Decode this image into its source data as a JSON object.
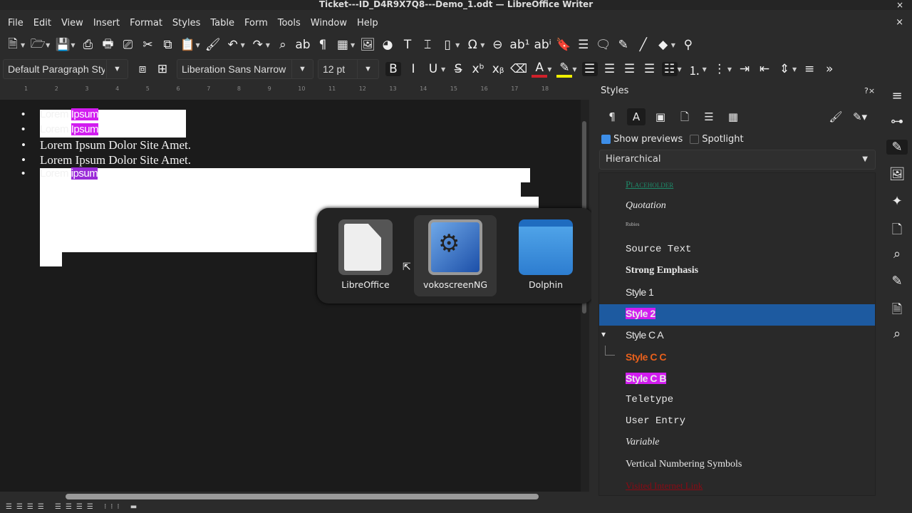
{
  "window": {
    "title": "Ticket---ID_D4R9X7Q8---Demo_1.odt — LibreOffice Writer",
    "close": "×"
  },
  "menu": [
    "File",
    "Edit",
    "View",
    "Insert",
    "Format",
    "Styles",
    "Table",
    "Form",
    "Tools",
    "Window",
    "Help"
  ],
  "doc_close": "×",
  "toolbar1": [
    {
      "n": "new-document-icon",
      "g": "🗎",
      "dd": true
    },
    {
      "n": "open-icon",
      "g": "🗁",
      "dd": true
    },
    {
      "n": "save-icon",
      "g": "💾",
      "dd": true
    },
    {
      "n": "export-pdf-icon",
      "g": "⎙"
    },
    {
      "n": "print-icon",
      "g": "🖶"
    },
    {
      "n": "print-preview-icon",
      "g": "⎚"
    },
    {
      "n": "cut-icon",
      "g": "✂"
    },
    {
      "n": "copy-icon",
      "g": "⧉"
    },
    {
      "n": "paste-icon",
      "g": "📋",
      "dd": true
    },
    {
      "n": "clone-formatting-icon",
      "g": "🖌"
    },
    {
      "n": "undo-icon",
      "g": "↶",
      "dd": true
    },
    {
      "n": "redo-icon",
      "g": "↷",
      "dd": true
    },
    {
      "n": "find-replace-icon",
      "g": "⌕"
    },
    {
      "n": "spelling-icon",
      "g": "ab"
    },
    {
      "n": "formatting-marks-icon",
      "g": "¶"
    },
    {
      "n": "insert-table-icon",
      "g": "▦",
      "dd": true
    },
    {
      "n": "insert-image-icon",
      "g": "🖼"
    },
    {
      "n": "insert-chart-icon",
      "g": "◕"
    },
    {
      "n": "insert-textbox-icon",
      "g": "T"
    },
    {
      "n": "page-break-icon",
      "g": "⌶"
    },
    {
      "n": "insert-field-icon",
      "g": "▯",
      "dd": true
    },
    {
      "n": "special-character-icon",
      "g": "Ω",
      "dd": true
    },
    {
      "n": "hyperlink-icon",
      "g": "⊖"
    },
    {
      "n": "footnote-icon",
      "g": "ab¹"
    },
    {
      "n": "endnote-icon",
      "g": "abⁱ"
    },
    {
      "n": "bookmark-icon",
      "g": "🔖"
    },
    {
      "n": "cross-reference-icon",
      "g": "☰"
    },
    {
      "n": "comment-icon",
      "g": "🗨"
    },
    {
      "n": "track-changes-icon",
      "g": "✎"
    },
    {
      "n": "line-icon",
      "g": "╱"
    },
    {
      "n": "shapes-icon",
      "g": "◆",
      "dd": true
    },
    {
      "n": "form-controls-icon",
      "g": "⚲"
    }
  ],
  "paragraph_style": "Default Paragraph Style",
  "font_name": "Liberation Sans Narrow",
  "font_size": "12 pt",
  "toolbar2": [
    {
      "n": "bold-icon",
      "g": "B",
      "a": true
    },
    {
      "n": "italic-icon",
      "g": "I"
    },
    {
      "n": "underline-icon",
      "g": "U",
      "dd": true
    },
    {
      "n": "strikethrough-icon",
      "g": "S̶"
    },
    {
      "n": "superscript-icon",
      "g": "xᵇ"
    },
    {
      "n": "subscript-icon",
      "g": "xᵦ"
    },
    {
      "n": "clear-formatting-icon",
      "g": "⌫"
    },
    {
      "n": "font-color-icon",
      "g": "A",
      "dd": true,
      "c": "#d0202a"
    },
    {
      "n": "highlight-icon",
      "g": "✎",
      "dd": true,
      "c": "#f0f000"
    },
    {
      "n": "align-left-icon",
      "g": "☰",
      "a": true
    },
    {
      "n": "align-center-icon",
      "g": "☰"
    },
    {
      "n": "align-right-icon",
      "g": "☰"
    },
    {
      "n": "justify-icon",
      "g": "☰"
    },
    {
      "n": "unordered-list-icon",
      "g": "☷",
      "dd": true,
      "a": true
    },
    {
      "n": "ordered-list-icon",
      "g": "⒈",
      "dd": true
    },
    {
      "n": "outline-list-icon",
      "g": "⋮",
      "dd": true
    },
    {
      "n": "increase-indent-icon",
      "g": "⇥"
    },
    {
      "n": "decrease-indent-icon",
      "g": "⇤"
    },
    {
      "n": "line-spacing-icon",
      "g": "⇕",
      "dd": true
    },
    {
      "n": "paragraph-spacing-icon",
      "g": "≡"
    },
    {
      "n": "more-icon",
      "g": "»"
    }
  ],
  "ruler": [
    "1",
    "2",
    "3",
    "4",
    "5",
    "6",
    "7",
    "8",
    "9",
    "10",
    "11",
    "12",
    "13",
    "14",
    "15",
    "16",
    "17",
    "18"
  ],
  "document": {
    "lines": [
      {
        "a": "Lorem ",
        "b": "Ipsum"
      },
      {
        "a": "Lorem ",
        "b": "Ipsum"
      },
      {
        "t": "Lorem Ipsum Dolor Site Amet."
      },
      {
        "t": "Lorem Ipsum Dolor Site Amet."
      },
      {
        "a": "Lorem ",
        "b": "ipsum"
      }
    ],
    "bullet": "•"
  },
  "switcher": {
    "apps": [
      "LibreOffice",
      "vokoscreenNG",
      "Dolphin"
    ],
    "selected": "vokoscreenNG"
  },
  "sidebar": {
    "title": "Styles",
    "help": "?×",
    "show_previews": "Show previews",
    "spotlight": "Spotlight",
    "filter": "Hierarchical",
    "styles": [
      "Placeholder",
      "Quotation",
      "Rubies",
      "Source Text",
      "Strong Emphasis",
      "Style 1",
      "Style 2",
      "Style C A",
      "Style C C",
      "Style C B",
      "Teletype",
      "User Entry",
      "Variable",
      "Vertical Numbering Symbols",
      "Visited Internet Link"
    ],
    "selected": "Style 2"
  },
  "colors": {
    "accent": "#1d5aa0",
    "highlight": "#d21cf0"
  }
}
